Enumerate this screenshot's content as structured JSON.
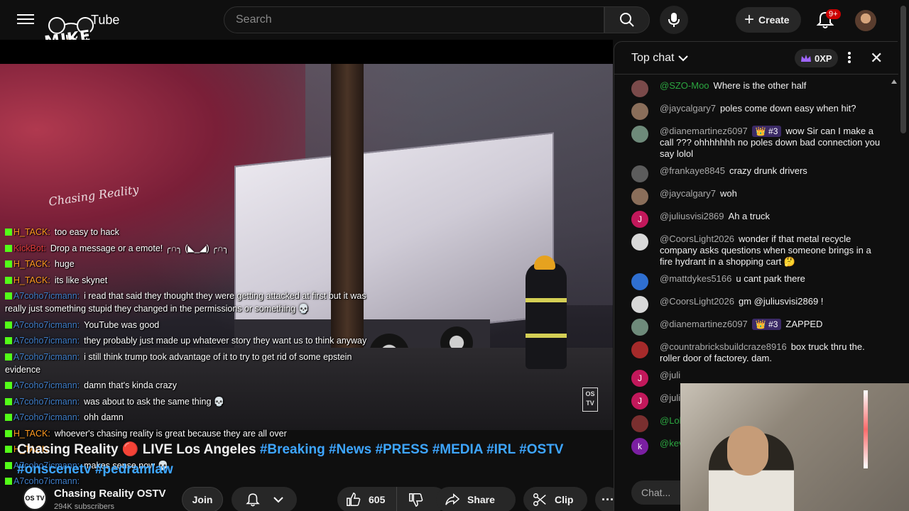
{
  "header": {
    "logo_text": "MIKE LIAORY",
    "logo_suffix": "Tube",
    "search_placeholder": "Search",
    "create_label": "Create",
    "notification_count": "9+"
  },
  "video": {
    "watermark": "Chasing Reality",
    "corner_logo": "OS TV",
    "overlay_chat": [
      {
        "user": "H_TACK:",
        "user_color": "orange",
        "text": "too easy to hack"
      },
      {
        "user": "KickBot:",
        "user_color": "red",
        "text": "Drop a message or a emote! ╭∩╮ (◣_◢) ╭∩╮"
      },
      {
        "user": "H_TACK:",
        "user_color": "orange",
        "text": "huge"
      },
      {
        "user": "H_TACK:",
        "user_color": "orange",
        "text": "its like skynet"
      },
      {
        "user": "A7coho7icmann:",
        "user_color": "blue",
        "text": "i read that said they thought they were getting attacked at first but it was really just something stupid they changed in the permissions or something 💀"
      },
      {
        "user": "A7coho7icmann:",
        "user_color": "blue",
        "text": "YouTube was good"
      },
      {
        "user": "A7coho7icmann:",
        "user_color": "blue",
        "text": "they probably just made up whatever story they want us to think anyway"
      },
      {
        "user": "A7coho7icmann:",
        "user_color": "blue",
        "text": "i still think trump took advantage of it to try to get rid of some epstein evidence"
      },
      {
        "user": "A7coho7icmann:",
        "user_color": "blue",
        "text": "damn that's kinda crazy"
      },
      {
        "user": "A7coho7icmann:",
        "user_color": "blue",
        "text": "was about to ask the same thing 💀"
      },
      {
        "user": "A7coho7icmann:",
        "user_color": "blue",
        "text": "ohh damn"
      },
      {
        "user": "H_TACK:",
        "user_color": "orange",
        "text": "whoever's chasing reality is great because they are all over"
      },
      {
        "user": "H_TACK:",
        "user_color": "orange",
        "text": ""
      },
      {
        "user": "A7coho7icmann:",
        "user_color": "blue",
        "text": "makes sense now 💀"
      },
      {
        "user": "A7coho7icmann:",
        "user_color": "blue",
        "text": ""
      }
    ]
  },
  "title": {
    "main": "Chasing Reality 🔴 LIVE Los Angeles",
    "hashtags_line1": "#Breaking #News #PRESS #MEDIA #IRL #OSTV",
    "hashtags_line2": "#onscenetv #pedramlaw"
  },
  "channel": {
    "avatar_text": "OS TV",
    "name": "Chasing Reality OSTV",
    "subscribers": "294K subscribers",
    "join_label": "Join",
    "like_count": "605",
    "share_label": "Share",
    "clip_label": "Clip"
  },
  "chat": {
    "mode_label": "Top chat",
    "xp_label": "0XP",
    "input_placeholder": "Chat...",
    "messages": [
      {
        "author": "@SZO-Moo",
        "author_style": "green",
        "badge": "",
        "text": "Where is the other half",
        "avatar": "",
        "avatar_color": "#7a4a4a"
      },
      {
        "author": "@jaycalgary7",
        "author_style": "",
        "badge": "",
        "text": "poles come down easy when hit?",
        "avatar": "",
        "avatar_color": "#8a6e5a"
      },
      {
        "author": "@dianemartinez6097",
        "author_style": "",
        "badge": "👑 #3",
        "text": "wow Sir can I make a call ??? ohhhhhhh no poles down bad connection you say lolol",
        "avatar": "",
        "avatar_color": "#6e8a7a"
      },
      {
        "author": "@frankaye8845",
        "author_style": "",
        "badge": "",
        "text": "crazy drunk drivers",
        "avatar": "",
        "avatar_color": "#5c5c5c"
      },
      {
        "author": "@jaycalgary7",
        "author_style": "",
        "badge": "",
        "text": "woh",
        "avatar": "",
        "avatar_color": "#8a6e5a"
      },
      {
        "author": "@juliusvisi2869",
        "author_style": "",
        "badge": "",
        "text": "Ah a truck",
        "avatar": "J",
        "avatar_color": "#c2185b"
      },
      {
        "author": "@CoorsLight2026",
        "author_style": "",
        "badge": "",
        "text": "wonder if that metal recycle company asks questions when someone brings in a fire hydrant in a shopping cart 🤔",
        "avatar": "",
        "avatar_color": "#d8d8d8"
      },
      {
        "author": "@mattdykes5166",
        "author_style": "",
        "badge": "",
        "text": "u cant park there",
        "avatar": "",
        "avatar_color": "#2f6fd0"
      },
      {
        "author": "@CoorsLight2026",
        "author_style": "",
        "badge": "",
        "text": "gm @juliusvisi2869 !",
        "avatar": "",
        "avatar_color": "#d8d8d8"
      },
      {
        "author": "@dianemartinez6097",
        "author_style": "",
        "badge": "👑 #3",
        "text": "ZAPPED",
        "avatar": "",
        "avatar_color": "#6e8a7a"
      },
      {
        "author": "@countrabricksbuildcraze8916",
        "author_style": "",
        "badge": "",
        "text": "box truck thru the. roller door of factorey. dam.",
        "avatar": "",
        "avatar_color": "#a52a2a"
      },
      {
        "author": "@juli",
        "author_style": "",
        "badge": "",
        "text": "",
        "avatar": "J",
        "avatar_color": "#c2185b"
      },
      {
        "author": "@juli",
        "author_style": "",
        "badge": "",
        "text": "",
        "avatar": "J",
        "avatar_color": "#c2185b"
      },
      {
        "author": "@Lol",
        "author_style": "green",
        "badge": "",
        "text": "",
        "avatar": "",
        "avatar_color": "#7a2f2f"
      },
      {
        "author": "@kev",
        "author_style": "green",
        "badge": "",
        "text": "",
        "avatar": "k",
        "avatar_color": "#7b1fa2"
      }
    ]
  },
  "colors": {
    "accent_red": "#cc0000",
    "link_blue": "#3ea6ff",
    "chat_green": "#2ba640",
    "member_badge": "#3b2a66"
  }
}
